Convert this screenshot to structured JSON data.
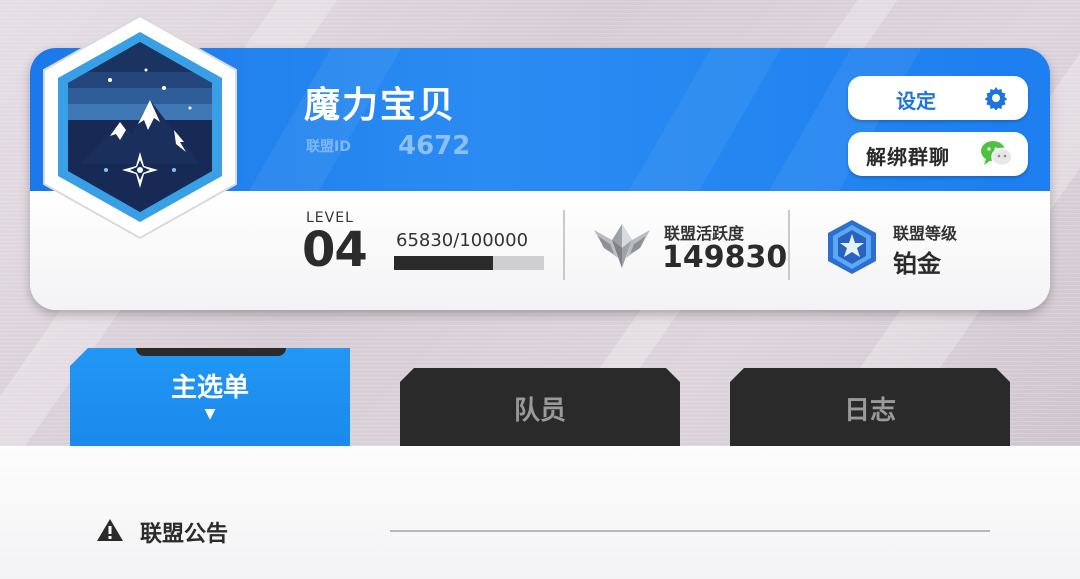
{
  "union": {
    "name": "魔力宝贝",
    "id_label": "联盟ID",
    "id_value": "4672"
  },
  "buttons": {
    "settings": "设定",
    "unbind_group": "解绑群聊"
  },
  "level": {
    "label": "LEVEL",
    "value": "04",
    "exp_text": "65830/100000",
    "exp_current": 65830,
    "exp_max": 100000
  },
  "activity": {
    "label": "联盟活跃度",
    "value": "149830"
  },
  "rank": {
    "label": "联盟等级",
    "value": "铂金"
  },
  "tabs": [
    {
      "label": "主选单",
      "active": true
    },
    {
      "label": "队员",
      "active": false
    },
    {
      "label": "日志",
      "active": false
    }
  ],
  "tab_active_marker": "▼",
  "notice": {
    "title": "联盟公告"
  },
  "colors": {
    "accent_blue": "#1a78ea",
    "tab_active": "#2297f4",
    "tab_inactive": "#2a2a2a",
    "wechat_green": "#4cc240"
  },
  "icons": [
    "mountain-emblem-icon",
    "gear-icon",
    "wechat-icon",
    "silver-wings-icon",
    "platinum-star-badge-icon",
    "warning-icon"
  ]
}
